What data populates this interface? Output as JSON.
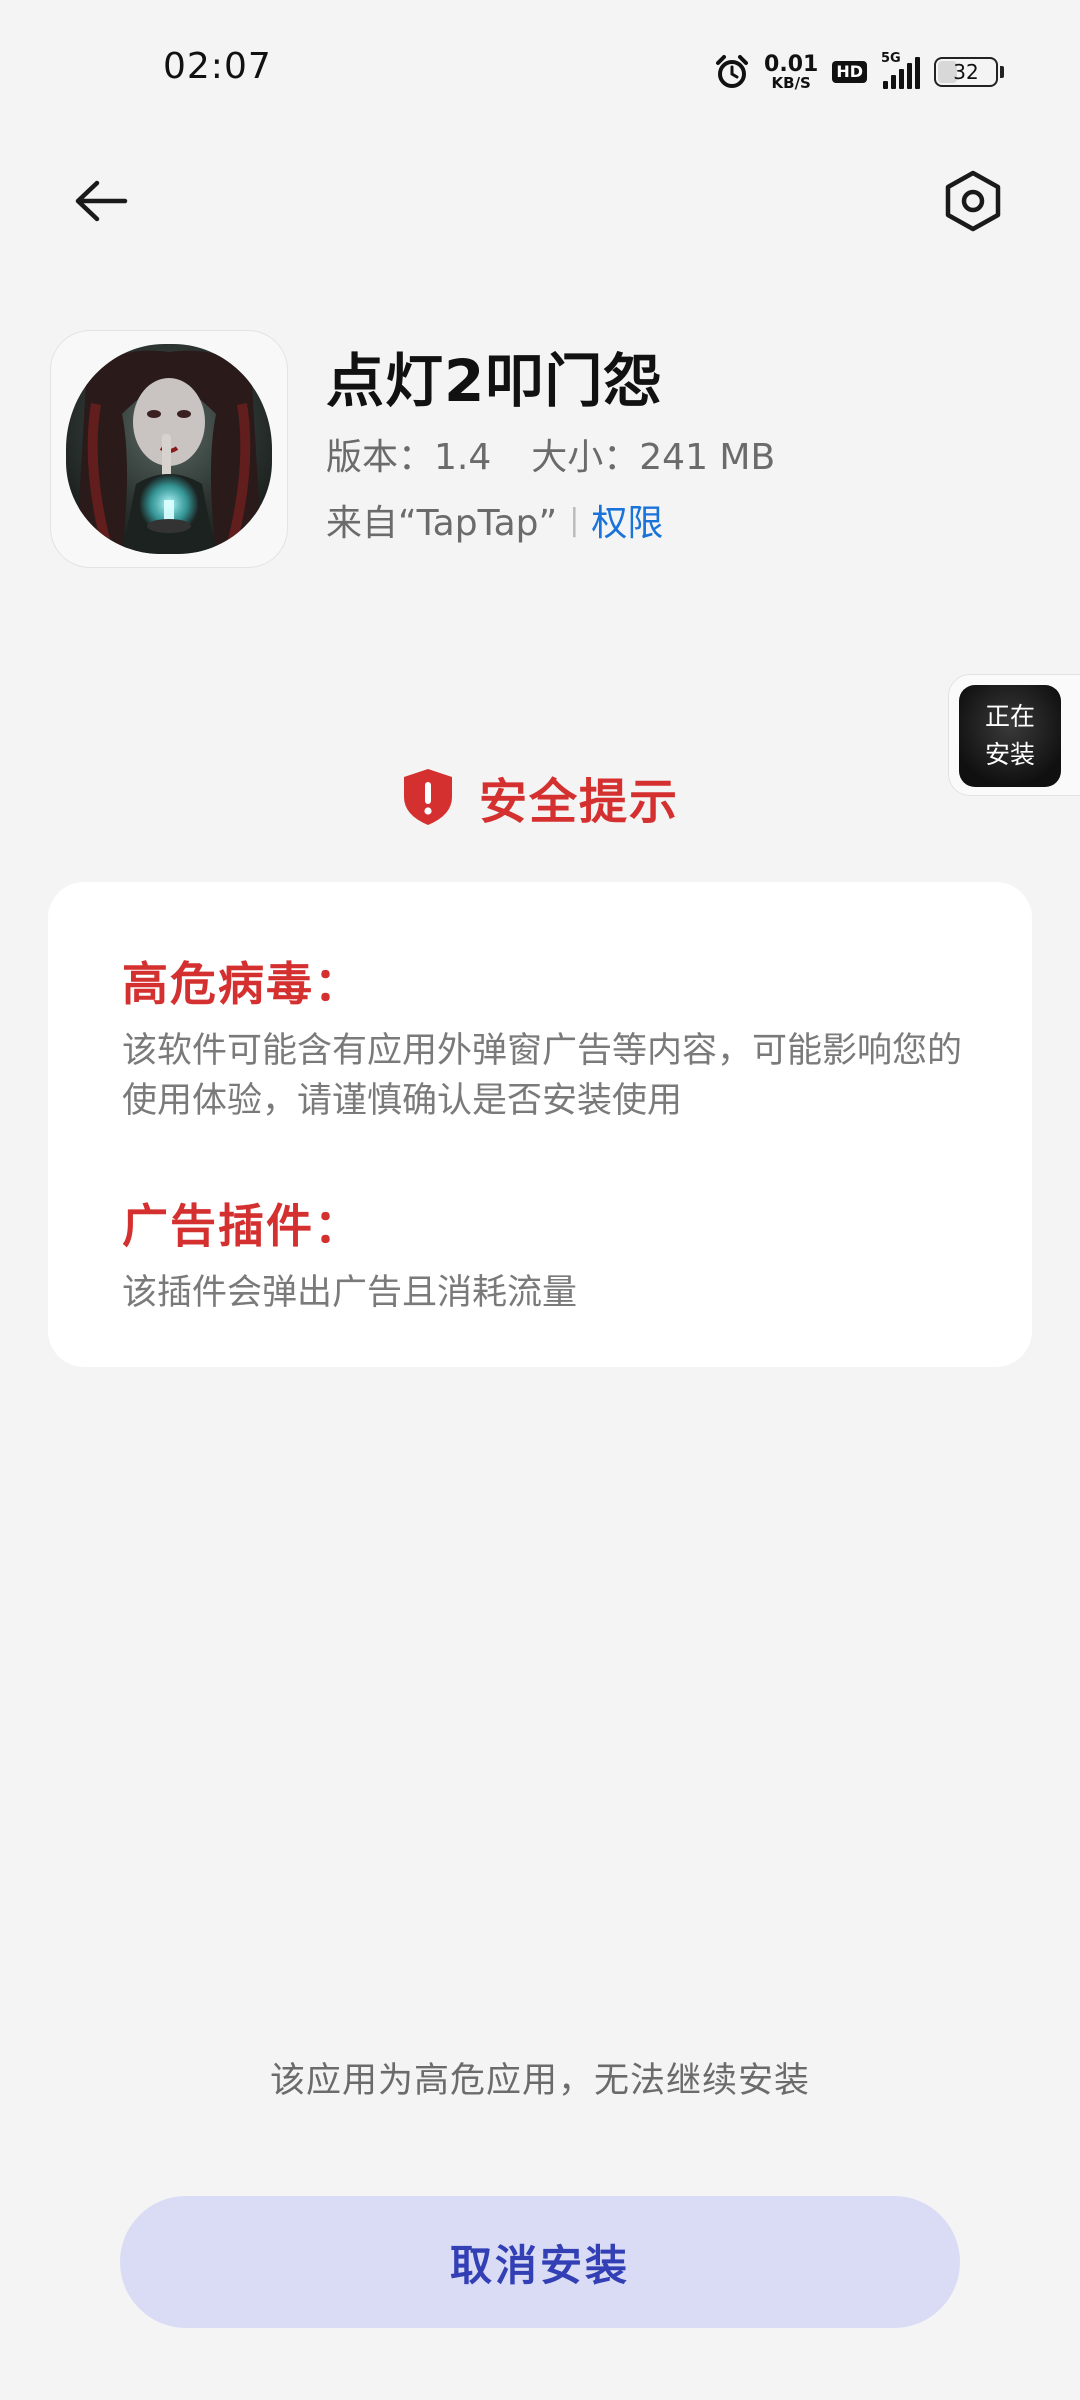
{
  "status_bar": {
    "time": "02:07",
    "net_speed_value": "0.01",
    "net_speed_unit": "KB/S",
    "hd_badge": "HD",
    "network_type": "5G",
    "battery_level": "32"
  },
  "header": {
    "back_icon": "arrow-left-icon",
    "settings_icon": "hexagon-settings-icon"
  },
  "app": {
    "name": "点灯2叩门怨",
    "version": "版本：1.4",
    "size": "大小：241 MB",
    "source": "来自“TapTap”",
    "separator": "|",
    "permissions_link": "权限"
  },
  "floating_install": {
    "line1": "正在",
    "line2": "安装"
  },
  "security": {
    "title": "安全提示",
    "icon": "shield-alert-icon",
    "accent_color": "#d3302f",
    "risks": [
      {
        "title": "高危病毒：",
        "description": "该软件可能含有应用外弹窗广告等内容，可能影响您的使用体验，请谨慎确认是否安装使用"
      },
      {
        "title": "广告插件：",
        "description": "该插件会弹出广告且消耗流量"
      }
    ]
  },
  "footer": {
    "note": "该应用为高危应用，无法继续安装",
    "cancel_label": "取消安装",
    "button_bg": "#d9dcf4",
    "button_text_color": "#3340b5"
  }
}
